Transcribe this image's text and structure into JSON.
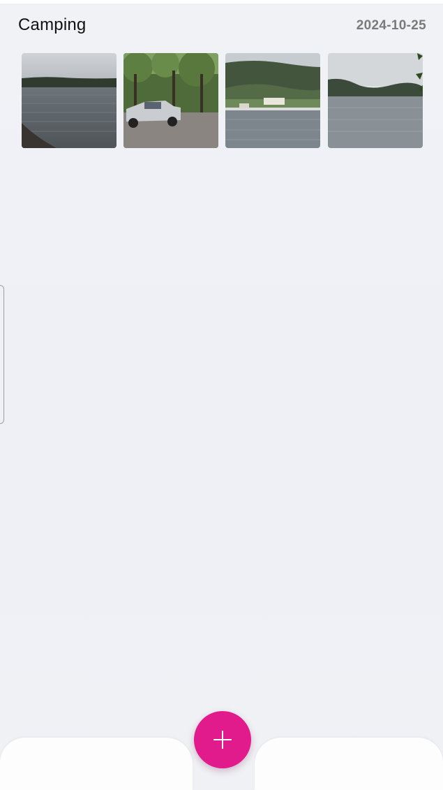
{
  "album": {
    "title": "Camping",
    "date": "2024-10-25"
  },
  "photos": [
    {
      "name": "lake-shore-photo",
      "icon": "photo-lake-shore"
    },
    {
      "name": "truck-campsite-photo",
      "icon": "photo-truck-campsite"
    },
    {
      "name": "marina-mountain-photo",
      "icon": "photo-marina-mountain"
    },
    {
      "name": "lake-mist-photo",
      "icon": "photo-lake-mist"
    }
  ],
  "fab": {
    "icon": "plus-icon",
    "color": "#e11b8c"
  },
  "colors": {
    "background": "#f0f1f5",
    "bottom_bar": "#fdfdfe",
    "date_text": "#7a7a7a"
  }
}
